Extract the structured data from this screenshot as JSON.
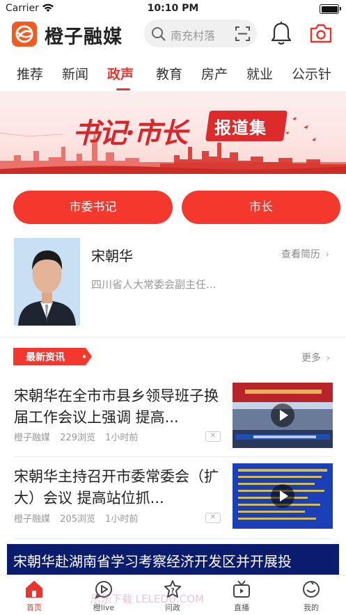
{
  "status_bar": {
    "carrier": "Carrier",
    "time": "10:10 PM"
  },
  "header": {
    "brand_name": "橙子融媒",
    "search_placeholder": "南充村落",
    "icons": [
      "search-icon",
      "scan-icon",
      "bell-icon",
      "camera-icon"
    ]
  },
  "tabs": [
    {
      "label": "推荐",
      "active": false
    },
    {
      "label": "新闻",
      "active": false
    },
    {
      "label": "政声",
      "active": true
    },
    {
      "label": "教育",
      "active": false
    },
    {
      "label": "房产",
      "active": false
    },
    {
      "label": "就业",
      "active": false
    },
    {
      "label": "公示针",
      "active": false
    }
  ],
  "banner": {
    "title": "书记·市长",
    "tag": "报道集"
  },
  "buttons": {
    "secretary": "市委书记",
    "mayor": "市长"
  },
  "person": {
    "name": "宋朝华",
    "resume_link": "查看简历",
    "title": "四川省人大常委会副主任..."
  },
  "latest": {
    "label": "最新资讯",
    "more": "更多",
    "items": [
      {
        "title": "宋朝华在全市市县乡领导班子换届工作会议上强调  提高...",
        "source": "橙子融媒",
        "views": "229浏览",
        "time": "1小时前"
      },
      {
        "title": "宋朝华主持召开市委常委会（扩大）会议  提高站位抓...",
        "source": "橙子融媒",
        "views": "205浏览",
        "time": "1小时前"
      }
    ],
    "feature_title": "宋朝华赴湖南省学习考察经济开发区并开展投"
  },
  "bottom_nav": [
    {
      "label": "首页",
      "active": true,
      "icon": "home-icon"
    },
    {
      "label": "橙live",
      "active": false,
      "icon": "live-icon"
    },
    {
      "label": "问政",
      "active": false,
      "icon": "question-icon"
    },
    {
      "label": "直播",
      "active": false,
      "icon": "tv-icon"
    },
    {
      "label": "我的",
      "active": false,
      "icon": "profile-icon"
    }
  ],
  "watermark": "乐乐下载 LELEDU.COM",
  "colors": {
    "accent": "#e8352e",
    "button_red": "#f4382d",
    "brand_orange": "#f15a22"
  }
}
